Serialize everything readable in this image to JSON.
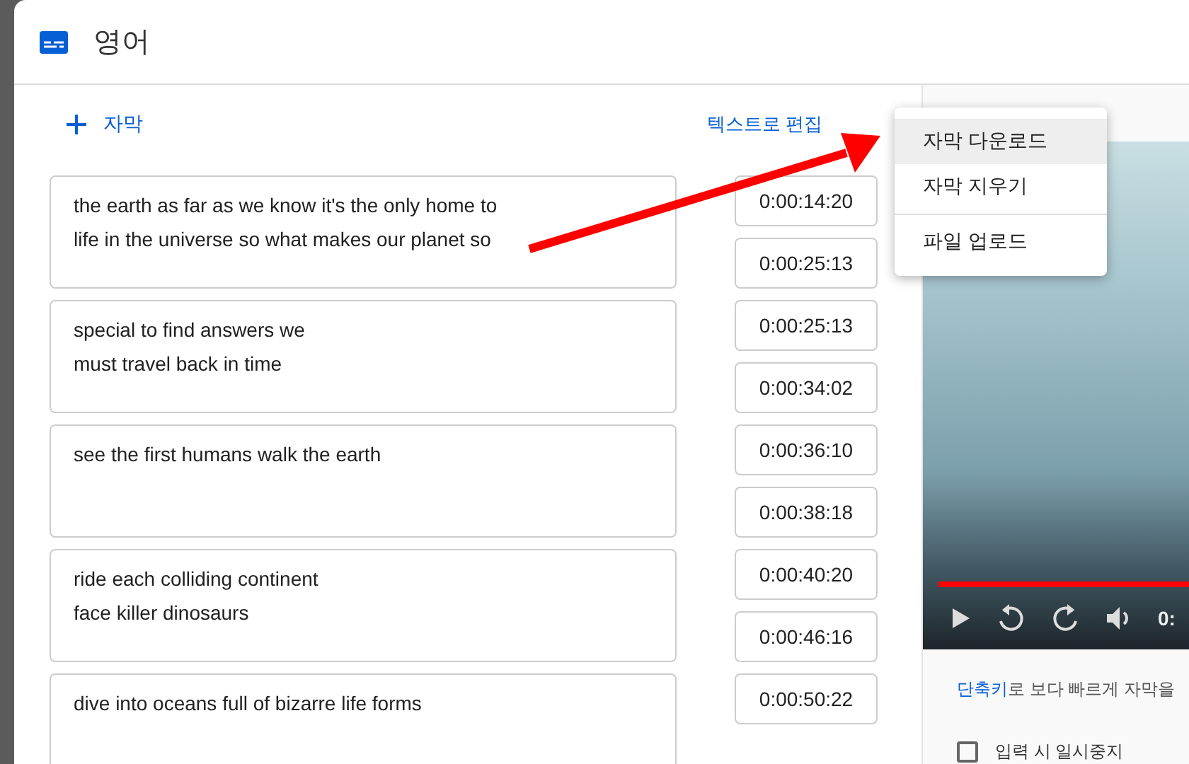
{
  "dialog": {
    "title": "영어"
  },
  "toolbar": {
    "add_button": "자막",
    "edit_as_text_link": "텍스트로 편집"
  },
  "menu": {
    "groups": [
      [
        {
          "label": "자막 다운로드",
          "selected": true
        },
        {
          "label": "자막 지우기",
          "selected": false
        }
      ],
      [
        {
          "label": "파일 업로드",
          "selected": false
        }
      ]
    ]
  },
  "segments": [
    {
      "lines": [
        "the earth as far as we know it's the only home to",
        "life in the universe so what makes our planet so"
      ],
      "start": "0:00:14:20",
      "end": "0:00:25:13"
    },
    {
      "lines": [
        "special to find answers we",
        "must travel back in time"
      ],
      "start": "0:00:25:13",
      "end": "0:00:34:02"
    },
    {
      "lines": [
        "see the first humans walk the earth"
      ],
      "start": "0:00:36:10",
      "end": "0:00:38:18"
    },
    {
      "lines": [
        "ride each colliding continent",
        "face killer dinosaurs"
      ],
      "start": "0:00:40:20",
      "end": "0:00:46:16"
    },
    {
      "lines": [
        "dive into oceans full of bizarre life forms"
      ],
      "start": "0:00:50:22"
    }
  ],
  "player": {
    "progress": {
      "level": 1
    },
    "time": "0:"
  },
  "shortcut_hint": {
    "link": "단축키",
    "text": "로 보다 빠르게 자막을"
  },
  "pause_while_typing": {
    "label": "입력 시 일시중지",
    "checked": false
  }
}
